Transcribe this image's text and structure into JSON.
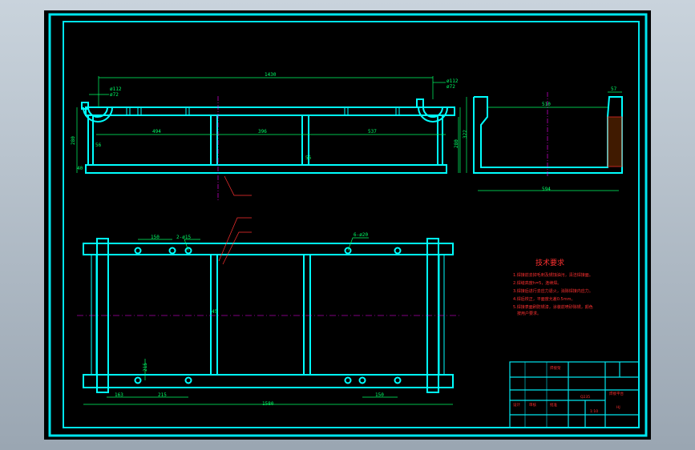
{
  "colors": {
    "background": "#000000",
    "frame": "#00e5ee",
    "part": "#00ffff",
    "dimension": "#00ff66",
    "centerline": "#ff00ff",
    "notes": "#ff3030",
    "leaders": "#ff3030"
  },
  "front_view": {
    "overall_length": "1430",
    "left_hole_outer": "ø112",
    "left_hole_inner": "ø72",
    "right_hole_outer": "ø112",
    "right_hole_inner": "ø72",
    "span_left": "494",
    "span_middle": "396",
    "span_right": "537",
    "height": "280",
    "offset_small_left": "56",
    "offset_small_mid": "56",
    "bottom_small": "40"
  },
  "side_view": {
    "top_width": "57",
    "inner_width": "510",
    "overall_height": "322",
    "inner_height": "280",
    "bottom_width": "594"
  },
  "plan_view": {
    "dim_150_top": "150",
    "holes_left": "2-ø15",
    "holes_right": "6-ø20",
    "dim_45": "45",
    "dim_215_vertical": "215",
    "dim_163": "163",
    "dim_215_bottom": "215",
    "dim_150_bottom": "150",
    "overall_length": "1580"
  },
  "notes": {
    "title": "技术要求",
    "lines": [
      "1.焊接前去掉毛刺及锈蚀油污，清洁焊接面。",
      "2.焊缝高度h=5，连续焊。",
      "3.焊接后进行去应力退火，消除焊接内应力。",
      "4.焊后校正，平面度允差0.5mm。",
      "5.焊接表面刷防锈漆，涂装前喷砂除锈，颜色",
      "按用户要求。"
    ]
  },
  "title_block": {
    "part_name": "焊接架",
    "material": "Q235",
    "scale": "1:10",
    "drawing_no": "HJ",
    "designer": "设计",
    "checker": "审核",
    "approver": "批准",
    "company": "焊接平台"
  }
}
